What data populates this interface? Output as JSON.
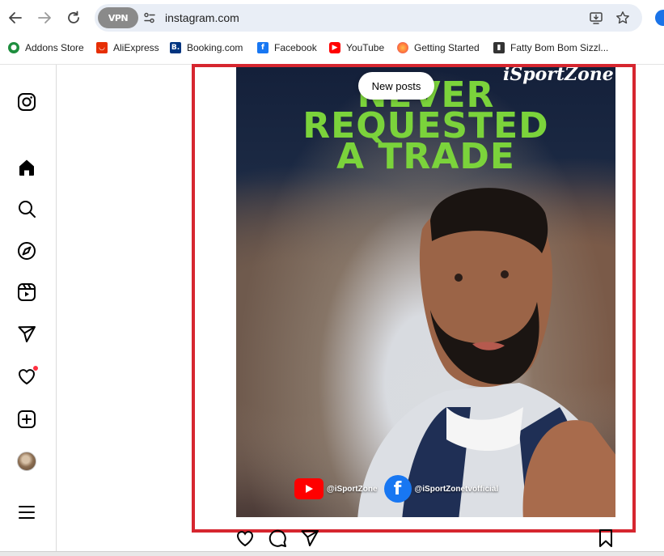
{
  "browser": {
    "vpn_label": "VPN",
    "url": "instagram.com",
    "bookmarks": [
      {
        "label": "Addons Store",
        "icon": "addons-store-icon",
        "color": "#1e8e3e"
      },
      {
        "label": "AliExpress",
        "icon": "aliexpress-icon",
        "color": "#e62e04"
      },
      {
        "label": "Booking.com",
        "icon": "booking-icon",
        "color": "#003580"
      },
      {
        "label": "Facebook",
        "icon": "facebook-icon",
        "color": "#1877f2"
      },
      {
        "label": "YouTube",
        "icon": "youtube-icon",
        "color": "#ff0000"
      },
      {
        "label": "Getting Started",
        "icon": "firefox-icon",
        "color": "#ff7139"
      },
      {
        "label": "Fatty Bom Bom Sizzl...",
        "icon": "bookmark-page-icon",
        "color": "#333333"
      }
    ]
  },
  "sidebar": {
    "items": [
      "instagram-logo",
      "home",
      "search",
      "explore",
      "reels",
      "messages",
      "notifications",
      "create",
      "profile",
      "more"
    ]
  },
  "feed": {
    "new_posts_label": "New posts",
    "post": {
      "brand_watermark": "iSportZone",
      "headline": [
        "NEVER",
        "REQUESTED",
        "A TRADE"
      ],
      "headline_color": "#7bd33b",
      "youtube_handle": "@iSportZone",
      "facebook_handle": "@iSportZonetvofficial",
      "facebook_letter": "f"
    },
    "highlight_color": "#d6262f"
  }
}
